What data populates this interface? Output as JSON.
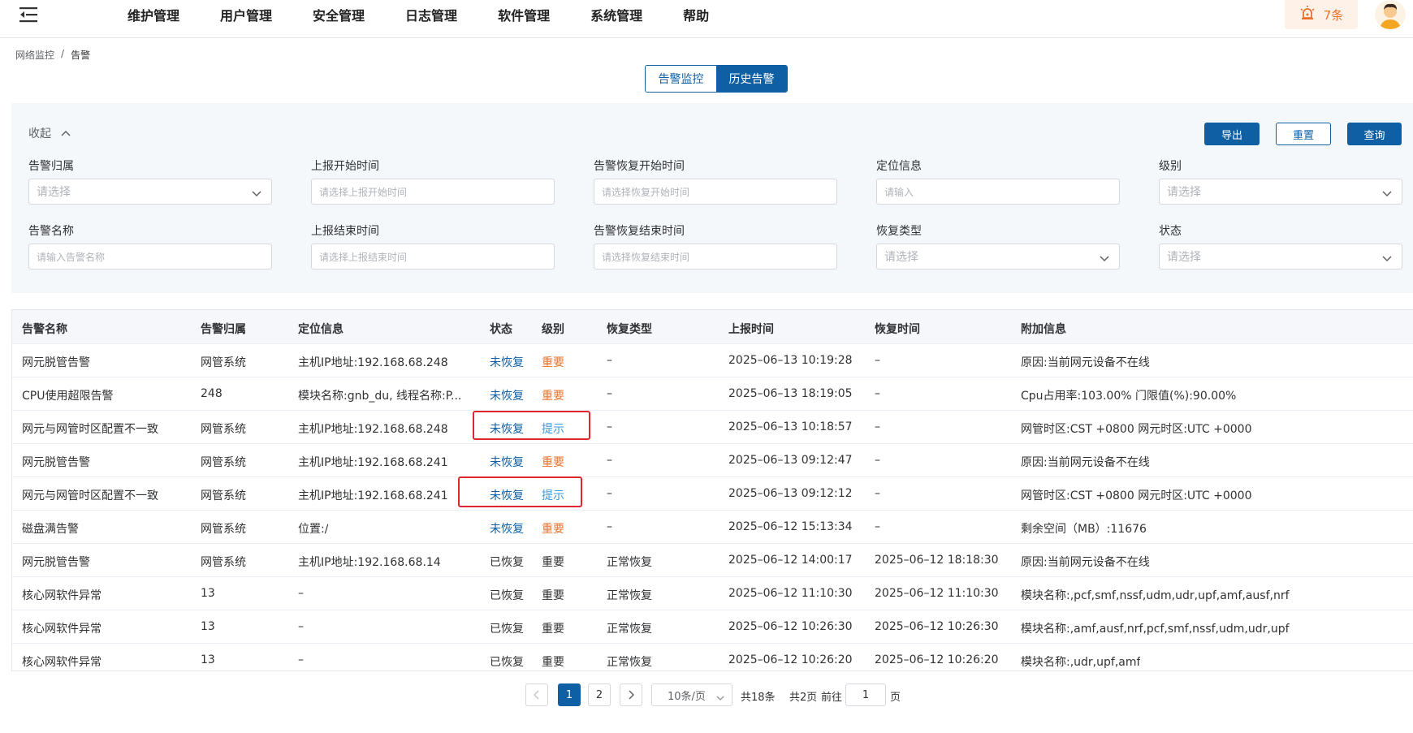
{
  "nav": {
    "items": [
      "维护管理",
      "用户管理",
      "安全管理",
      "日志管理",
      "软件管理",
      "系统管理",
      "帮助"
    ],
    "alarm_count": "7条"
  },
  "breadcrumb": {
    "parent": "网络监控",
    "separator": "/",
    "current": "告警"
  },
  "tabs": {
    "monitor": "告警监控",
    "history": "历史告警"
  },
  "filter": {
    "collapse_label": "收起",
    "export": "导出",
    "reset": "重置",
    "query": "查询",
    "fields": {
      "alarm_owner": {
        "label": "告警归属",
        "placeholder": "请选择"
      },
      "report_start": {
        "label": "上报开始时间",
        "placeholder": "请选择上报开始时间"
      },
      "recover_start": {
        "label": "告警恢复开始时间",
        "placeholder": "请选择恢复开始时间"
      },
      "location": {
        "label": "定位信息",
        "placeholder": "请输入"
      },
      "level": {
        "label": "级别",
        "placeholder": "请选择"
      },
      "alarm_name": {
        "label": "告警名称",
        "placeholder": "请输入告警名称"
      },
      "report_end": {
        "label": "上报结束时间",
        "placeholder": "请选择上报结束时间"
      },
      "recover_end": {
        "label": "告警恢复结束时间",
        "placeholder": "请选择恢复结束时间"
      },
      "recover_type": {
        "label": "恢复类型",
        "placeholder": "请选择"
      },
      "status": {
        "label": "状态",
        "placeholder": "请选择"
      }
    }
  },
  "table": {
    "headers": [
      "告警名称",
      "告警归属",
      "定位信息",
      "状态",
      "级别",
      "恢复类型",
      "上报时间",
      "恢复时间",
      "附加信息"
    ],
    "rows": [
      [
        "网元脱管告警",
        "网管系统",
        "主机IP地址:192.168.68.248",
        "未恢复",
        "重要",
        "–",
        "2025–06–13 10:19:28",
        "–",
        "原因:当前网元设备不在线"
      ],
      [
        "CPU使用超限告警",
        "248",
        "模块名称:gnb_du, 线程名称:P...",
        "未恢复",
        "重要",
        "–",
        "2025–06–13 18:19:05",
        "–",
        "Cpu占用率:103.00% 门限值(%):90.00%"
      ],
      [
        "网元与网管时区配置不一致",
        "网管系统",
        "主机IP地址:192.168.68.248",
        "未恢复",
        "提示",
        "–",
        "2025–06–13 10:18:57",
        "–",
        "网管时区:CST +0800 网元时区:UTC +0000"
      ],
      [
        "网元脱管告警",
        "网管系统",
        "主机IP地址:192.168.68.241",
        "未恢复",
        "重要",
        "–",
        "2025–06–13 09:12:47",
        "–",
        "原因:当前网元设备不在线"
      ],
      [
        "网元与网管时区配置不一致",
        "网管系统",
        "主机IP地址:192.168.68.241",
        "未恢复",
        "提示",
        "–",
        "2025–06–13 09:12:12",
        "–",
        "网管时区:CST +0800 网元时区:UTC +0000"
      ],
      [
        "磁盘满告警",
        "网管系统",
        "位置:/",
        "未恢复",
        "重要",
        "–",
        "2025–06–12 15:13:34",
        "–",
        "剩余空间（MB）:11676"
      ],
      [
        "网元脱管告警",
        "网管系统",
        "主机IP地址:192.168.68.14",
        "已恢复",
        "重要",
        "正常恢复",
        "2025–06–12 14:00:17",
        "2025–06–12 18:18:30",
        "原因:当前网元设备不在线"
      ],
      [
        "核心网软件异常",
        "13",
        "–",
        "已恢复",
        "重要",
        "正常恢复",
        "2025–06–12 11:10:30",
        "2025–06–12 11:10:30",
        "模块名称:,pcf,smf,nssf,udm,udr,upf,amf,ausf,nrf"
      ],
      [
        "核心网软件异常",
        "13",
        "–",
        "已恢复",
        "重要",
        "正常恢复",
        "2025–06–12 10:26:30",
        "2025–06–12 10:26:30",
        "模块名称:,amf,ausf,nrf,pcf,smf,nssf,udm,udr,upf"
      ],
      [
        "核心网软件异常",
        "13",
        "–",
        "已恢复",
        "重要",
        "正常恢复",
        "2025–06–12 10:26:20",
        "2025–06–12 10:26:20",
        "模块名称:,udr,upf,amf"
      ]
    ]
  },
  "pagination": {
    "pages": [
      "1",
      "2"
    ],
    "current": "1",
    "page_size": "10条/页",
    "total": "共18条",
    "total_pages": "共2页",
    "goto_prefix": "前往",
    "goto_value": "1",
    "goto_suffix": "页"
  },
  "colors": {
    "primary": "#0e5fa3",
    "important": "#e8722c",
    "hint": "#3a9be0",
    "highlight": "#e0262d"
  }
}
